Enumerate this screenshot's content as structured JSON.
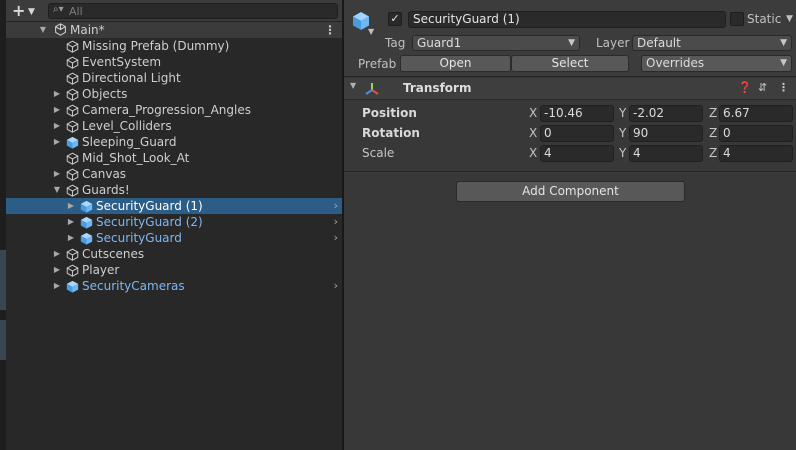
{
  "hierarchy": {
    "add_label": "+",
    "search_placeholder": "All",
    "scene_name": "Main*",
    "items": [
      {
        "label": "Missing Prefab (Dummy)",
        "indent": 1,
        "arrow": false,
        "prefab": false
      },
      {
        "label": "EventSystem",
        "indent": 1,
        "arrow": false,
        "prefab": false
      },
      {
        "label": "Directional Light",
        "indent": 1,
        "arrow": false,
        "prefab": false
      },
      {
        "label": "Objects",
        "indent": 1,
        "arrow": "right",
        "prefab": false
      },
      {
        "label": "Camera_Progression_Angles",
        "indent": 1,
        "arrow": "right",
        "prefab": false
      },
      {
        "label": "Level_Colliders",
        "indent": 1,
        "arrow": "right",
        "prefab": false
      },
      {
        "label": "Sleeping_Guard",
        "indent": 1,
        "arrow": "right",
        "prefab": "partial"
      },
      {
        "label": "Mid_Shot_Look_At",
        "indent": 1,
        "arrow": false,
        "prefab": false
      },
      {
        "label": "Canvas",
        "indent": 1,
        "arrow": "right",
        "prefab": false
      },
      {
        "label": "Guards!",
        "indent": 1,
        "arrow": "down",
        "prefab": false
      },
      {
        "label": "SecurityGuard (1)",
        "indent": 2,
        "arrow": "right",
        "prefab": true,
        "selected": true,
        "chevron": true
      },
      {
        "label": "SecurityGuard (2)",
        "indent": 2,
        "arrow": "right",
        "prefab": true,
        "chevron": true
      },
      {
        "label": "SecurityGuard",
        "indent": 2,
        "arrow": "right",
        "prefab": true,
        "chevron": true
      },
      {
        "label": "Cutscenes",
        "indent": 1,
        "arrow": "right",
        "prefab": false
      },
      {
        "label": "Player",
        "indent": 1,
        "arrow": "right",
        "prefab": false
      },
      {
        "label": "SecurityCameras",
        "indent": 1,
        "arrow": "right",
        "prefab": true,
        "chevron": true
      }
    ]
  },
  "inspector": {
    "object_name": "SecurityGuard (1)",
    "active_checked": true,
    "static_label": "Static",
    "tag_label": "Tag",
    "tag_value": "Guard1",
    "layer_label": "Layer",
    "layer_value": "Default",
    "prefab_label": "Prefab",
    "open_label": "Open",
    "select_label": "Select",
    "overrides_label": "Overrides",
    "transform": {
      "title": "Transform",
      "rows": [
        {
          "label": "Position",
          "bold": true,
          "x": "-10.46",
          "y": "-2.02",
          "z": "6.67"
        },
        {
          "label": "Rotation",
          "bold": true,
          "x": "0",
          "y": "90",
          "z": "0"
        },
        {
          "label": "Scale",
          "bold": false,
          "x": "4",
          "y": "4",
          "z": "4"
        }
      ],
      "axis_labels": [
        "X",
        "Y",
        "Z"
      ]
    },
    "add_component_label": "Add Component"
  },
  "colors": {
    "selection": "#2c5d87",
    "prefab_text": "#7cb7f4",
    "panel_bg": "#383838",
    "hierarchy_bg": "#282828"
  }
}
